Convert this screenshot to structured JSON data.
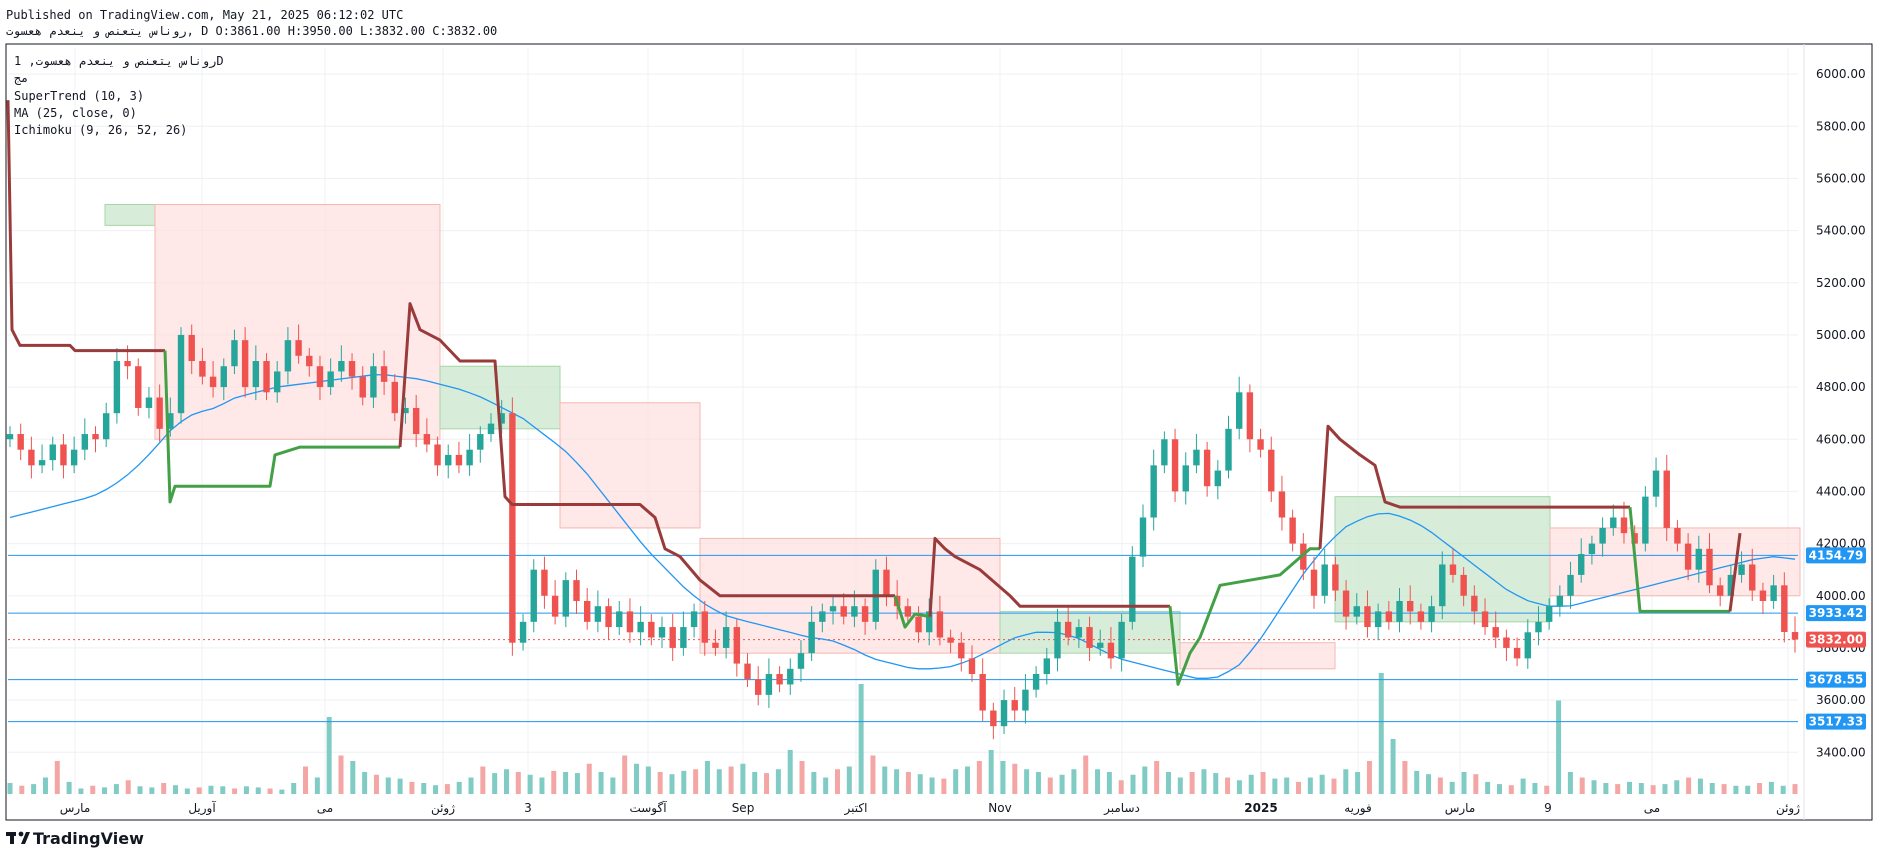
{
  "header": {
    "published": "Published on TradingView.com, May 21, 2025 06:12:02 UTC",
    "symbol_line": "روناس یتعنص و ینعدم هعسوت, D O:3861.00 H:3950.00 L:3832.00 C:3832.00"
  },
  "legend": {
    "symbol": "روناس یتعنص و ینعدم هعسوت, 1D",
    "exchange": "مج",
    "indicators": [
      "SuperTrend (10, 3)",
      "MA (25, close, 0)",
      "Ichimoku (9, 26, 52, 26)"
    ]
  },
  "brand": "TradingView",
  "colors": {
    "up": "#26a69a",
    "down": "#ef5350",
    "supertrend_up": "#43a047",
    "supertrend_down": "#9a3b3b",
    "ma": "#2196f3",
    "hline": "#2196f3",
    "cloud_bull": "#c8e6c9",
    "cloud_bear": "#fddede",
    "price_tag": "#ef5350",
    "level_tag": "#2196f3"
  },
  "chart_data": {
    "type": "candlestick",
    "timeframe": "1D",
    "ylim": [
      3240,
      6100
    ],
    "price_axis_ticks": [
      3400,
      3600,
      3800,
      4000,
      4200,
      4400,
      4600,
      4800,
      5000,
      5200,
      5400,
      5600,
      5800,
      6000
    ],
    "price_axis_labels": [
      "3400.00",
      "3600.00",
      "3800.00",
      "4000.00",
      "4200.00",
      "4400.00",
      "4600.00",
      "4800.00",
      "5000.00",
      "5200.00",
      "5400.00",
      "5600.00",
      "5800.00",
      "6000.00"
    ],
    "time_axis_labels": [
      "مارس",
      "آوریل",
      "می",
      "ژوئن",
      "3",
      "آگوست",
      "Sep",
      "اکتبر",
      "Nov",
      "دسامبر",
      "2025",
      "فوریه",
      "مارس",
      "9",
      "می",
      "ژوئن"
    ],
    "horizontal_levels": [
      {
        "value": 4154.79,
        "label": "4154.79"
      },
      {
        "value": 3933.42,
        "label": "3933.42"
      },
      {
        "value": 3678.55,
        "label": "3678.55"
      },
      {
        "value": 3517.33,
        "label": "3517.33"
      }
    ],
    "last_price": {
      "value": 3832.0,
      "label": "3832.00"
    },
    "last_candle": {
      "open": 3861.0,
      "high": 3950.0,
      "low": 3832.0,
      "close": 3832.0
    },
    "close_path": [
      4620,
      4560,
      4500,
      4520,
      4580,
      4500,
      4560,
      4620,
      4600,
      4700,
      4900,
      4880,
      4720,
      4760,
      4640,
      4700,
      5000,
      4900,
      4840,
      4800,
      4880,
      4980,
      4800,
      4900,
      4780,
      4860,
      4980,
      4920,
      4880,
      4800,
      4860,
      4900,
      4840,
      4760,
      4880,
      4820,
      4700,
      4720,
      4620,
      4580,
      4500,
      4540,
      4500,
      4560,
      4620,
      4660,
      4700,
      3820,
      3900,
      4100,
      4000,
      3920,
      4060,
      3980,
      3900,
      3960,
      3880,
      3940,
      3860,
      3900,
      3840,
      3880,
      3800,
      3880,
      3940,
      3820,
      3800,
      3880,
      3740,
      3680,
      3620,
      3700,
      3660,
      3720,
      3780,
      3900,
      3940,
      3960,
      3920,
      3960,
      3900,
      4100,
      4000,
      3960,
      3920,
      3860,
      3940,
      3840,
      3820,
      3760,
      3700,
      3560,
      3500,
      3600,
      3560,
      3640,
      3700,
      3760,
      3900,
      3840,
      3880,
      3800,
      3820,
      3760,
      3900,
      4150,
      4300,
      4500,
      4600,
      4400,
      4500,
      4560,
      4420,
      4480,
      4640,
      4780,
      4600,
      4560,
      4400,
      4300,
      4200,
      4100,
      4000,
      4120,
      4020,
      3920,
      3960,
      3880,
      3940,
      3900,
      3980,
      3940,
      3900,
      3960,
      4120,
      4080,
      4000,
      3940,
      3880,
      3840,
      3800,
      3760,
      3860,
      3900,
      3960,
      4000,
      4080,
      4160,
      4200,
      4260,
      4300,
      4240,
      4200,
      4380,
      4480,
      4260,
      4200,
      4100,
      4180,
      4040,
      4000,
      4080,
      4120,
      4020,
      3980,
      4040,
      3861,
      3832
    ],
    "ma_path": [
      4300,
      4320,
      4340,
      4360,
      4380,
      4420,
      4480,
      4560,
      4650,
      4700,
      4720,
      4760,
      4780,
      4800,
      4810,
      4820,
      4830,
      4840,
      4850,
      4840,
      4830,
      4810,
      4790,
      4760,
      4720,
      4680,
      4620,
      4560,
      4480,
      4380,
      4280,
      4180,
      4100,
      4020,
      3960,
      3920,
      3900,
      3880,
      3860,
      3840,
      3830,
      3800,
      3760,
      3740,
      3720,
      3720,
      3730,
      3760,
      3800,
      3840,
      3860,
      3860,
      3840,
      3800,
      3760,
      3740,
      3720,
      3700,
      3680,
      3690,
      3740,
      3840,
      3960,
      4080,
      4180,
      4260,
      4300,
      4320,
      4300,
      4260,
      4200,
      4140,
      4080,
      4020,
      3980,
      3960,
      3960,
      3980,
      4000,
      4020,
      4040,
      4060,
      4080,
      4100,
      4120,
      4140,
      4150,
      4140
    ],
    "volume_path": [
      20,
      15,
      18,
      30,
      60,
      22,
      10,
      15,
      12,
      18,
      25,
      14,
      12,
      20,
      16,
      10,
      12,
      15,
      14,
      10,
      14,
      12,
      10,
      8,
      20,
      50,
      30,
      140,
      70,
      60,
      40,
      35,
      30,
      28,
      22,
      20,
      16,
      18,
      22,
      30,
      50,
      38,
      45,
      40,
      35,
      30,
      42,
      40,
      38,
      55,
      40,
      30,
      70,
      55,
      50,
      40,
      36,
      42,
      45,
      60,
      45,
      50,
      55,
      40,
      38,
      45,
      80,
      60,
      40,
      30,
      45,
      50,
      200,
      70,
      50,
      45,
      40,
      36,
      30,
      28,
      45,
      50,
      60,
      80,
      60,
      55,
      45,
      40,
      30,
      35,
      45,
      70,
      45,
      40,
      25,
      35,
      50,
      60,
      40,
      30,
      40,
      45,
      38,
      30,
      25,
      35,
      40,
      28,
      30,
      22,
      30,
      35,
      28,
      45,
      40,
      60,
      220,
      100,
      60,
      42,
      36,
      30,
      22,
      40,
      36,
      22,
      18,
      16,
      28,
      20,
      15,
      170,
      40,
      30,
      25,
      20,
      18,
      22,
      20,
      16,
      18,
      25,
      30,
      28,
      20,
      18,
      15,
      15,
      20,
      22,
      15,
      18
    ]
  }
}
